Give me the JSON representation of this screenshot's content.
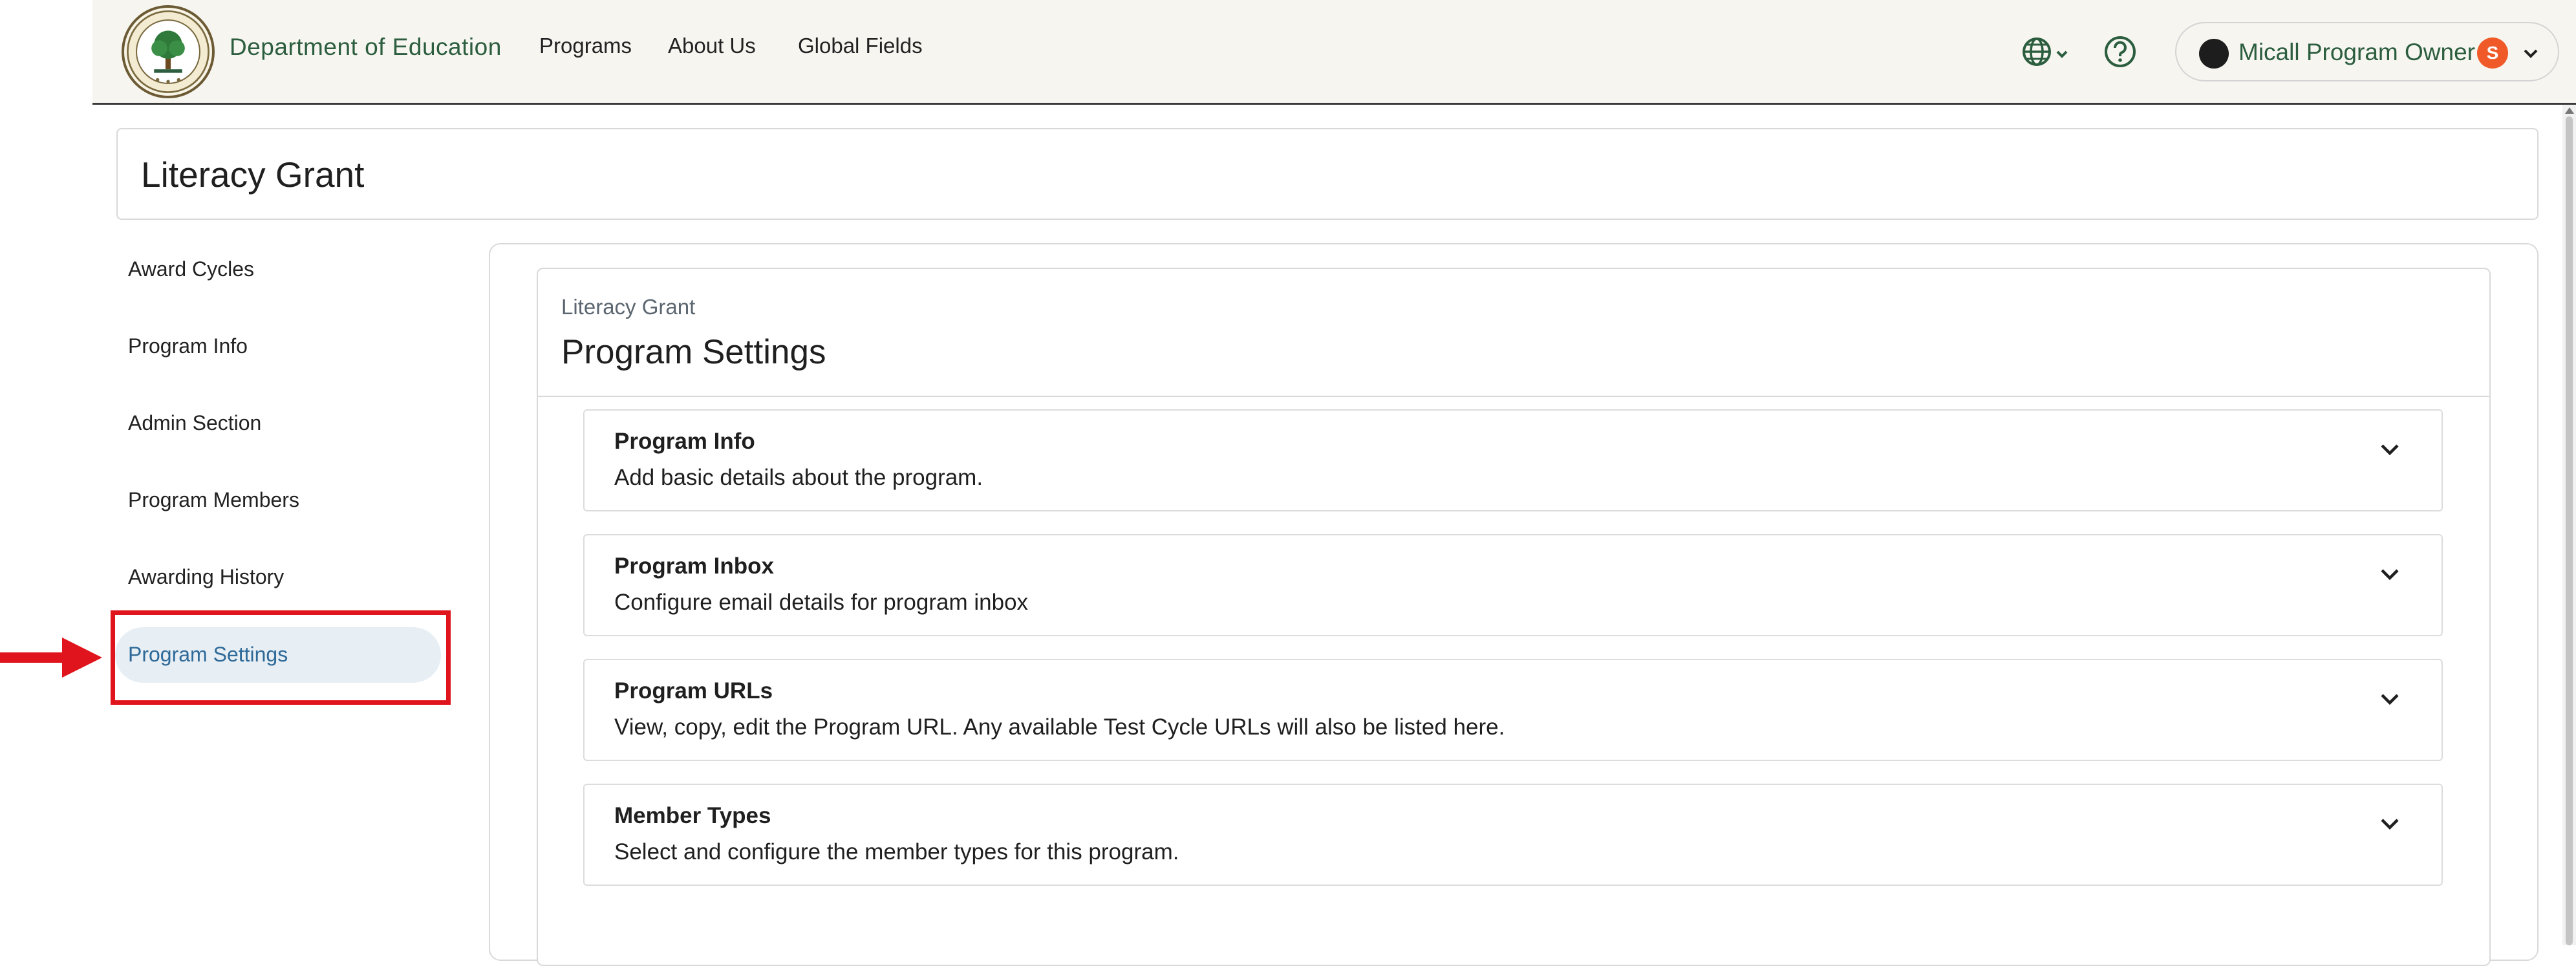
{
  "header": {
    "brand": "Department of Education",
    "nav": [
      {
        "label": "Programs"
      },
      {
        "label": "About Us"
      },
      {
        "label": "Global Fields"
      }
    ],
    "user": {
      "name": "Micall Program Owner",
      "badge": "S"
    }
  },
  "program": {
    "title": "Literacy Grant"
  },
  "sidebar": {
    "items": [
      {
        "label": "Award Cycles"
      },
      {
        "label": "Program Info"
      },
      {
        "label": "Admin Section"
      },
      {
        "label": "Program Members"
      },
      {
        "label": "Awarding History"
      },
      {
        "label": "Program Settings"
      }
    ],
    "active_index": 5
  },
  "settings": {
    "breadcrumb": "Literacy Grant",
    "title": "Program Settings",
    "sections": [
      {
        "title": "Program Info",
        "description": "Add basic details about the program."
      },
      {
        "title": "Program Inbox",
        "description": "Configure email details for program inbox"
      },
      {
        "title": "Program URLs",
        "description": "View, copy, edit the Program URL. Any available Test Cycle URLs will also be listed here."
      },
      {
        "title": "Member Types",
        "description": "Select and configure the member types for this program."
      }
    ]
  },
  "colors": {
    "brand_green": "#2b5d3e",
    "active_blue": "#2f6a98",
    "active_bg": "#e7eff5",
    "annotation_red": "#e0141c",
    "badge_orange": "#f05a28"
  },
  "icons": {
    "logo": "department-seal-icon",
    "language": "globe-icon",
    "help": "help-circle-icon",
    "user_menu": "chevron-down-icon",
    "accordion": "chevron-down-icon",
    "annotation": "arrow-right-icon"
  }
}
